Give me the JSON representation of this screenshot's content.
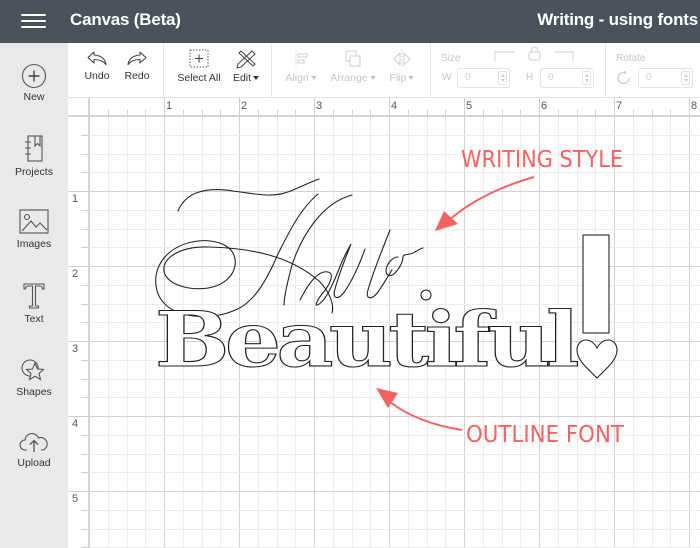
{
  "topbar": {
    "menu_icon": "hamburger-icon",
    "app_title": "Canvas (Beta)",
    "document_title": "Writing - using fonts"
  },
  "sidebar": {
    "items": [
      {
        "label": "New",
        "icon": "plus-circle-icon"
      },
      {
        "label": "Projects",
        "icon": "notebook-icon"
      },
      {
        "label": "Images",
        "icon": "image-icon"
      },
      {
        "label": "Text",
        "icon": "text-t-icon"
      },
      {
        "label": "Shapes",
        "icon": "shapes-icon"
      },
      {
        "label": "Upload",
        "icon": "cloud-upload-icon"
      }
    ]
  },
  "toolbar": {
    "undo": "Undo",
    "redo": "Redo",
    "select_all": "Select All",
    "edit": "Edit",
    "align": "Align",
    "arrange": "Arrange",
    "flip": "Flip",
    "size_label": "Size",
    "w_label": "W",
    "w_value": "0",
    "h_label": "H",
    "h_value": "0",
    "rotate_label": "Rotate",
    "rotate_value": "0"
  },
  "rulers": {
    "horizontal": [
      "1",
      "2",
      "3",
      "4",
      "5",
      "6",
      "7",
      "8"
    ],
    "vertical": [
      "1",
      "2",
      "3",
      "4",
      "5"
    ]
  },
  "canvas": {
    "script_text": "Hello",
    "outline_text": "Beautiful",
    "annotations": [
      {
        "text": "WRITING STYLE"
      },
      {
        "text": "OUTLINE FONT"
      }
    ],
    "annotation_color": "#f26362"
  }
}
